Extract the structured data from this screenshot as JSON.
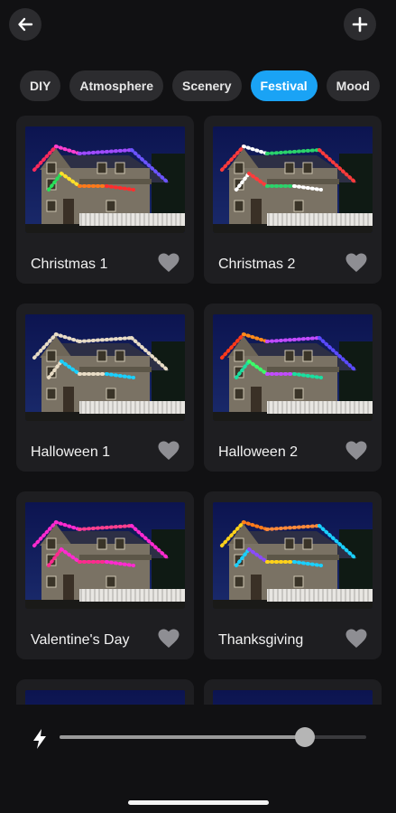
{
  "header": {
    "back_icon": "arrow-left-icon",
    "add_icon": "plus-icon"
  },
  "tabs": [
    {
      "label": "DIY",
      "active": false
    },
    {
      "label": "Atmosphere",
      "active": false
    },
    {
      "label": "Scenery",
      "active": false
    },
    {
      "label": "Festival",
      "active": true
    },
    {
      "label": "Mood",
      "active": false
    }
  ],
  "presets": [
    {
      "title": "Christmas 1",
      "roof_colors": [
        "#ff2a5c",
        "#ff3fd0",
        "#a04bff",
        "#6b54ff",
        "#2bd36b"
      ],
      "lower_colors": [
        "#28e05a",
        "#ffe02a",
        "#ff7a1a",
        "#ff2e2e"
      ],
      "favorite": false
    },
    {
      "title": "Christmas 2",
      "roof_colors": [
        "#ff3b3b",
        "#ffffff",
        "#2bd36b",
        "#ff3b3b"
      ],
      "lower_colors": [
        "#ffffff",
        "#ff3b3b",
        "#2bd36b"
      ],
      "favorite": false
    },
    {
      "title": "Halloween 1",
      "roof_colors": [
        "#e8dcc6",
        "#e8dcc6"
      ],
      "lower_colors": [
        "#e8dcc6",
        "#1ad0ff"
      ],
      "favorite": false
    },
    {
      "title": "Halloween 2",
      "roof_colors": [
        "#ff3a1a",
        "#ff8a1a",
        "#c24bff",
        "#5b4bff"
      ],
      "lower_colors": [
        "#1adfa0",
        "#3aff6a",
        "#c24bff"
      ],
      "favorite": false
    },
    {
      "title": "Valentine's Day",
      "roof_colors": [
        "#ff2ad0",
        "#ff2ad0",
        "#ff3f8f"
      ],
      "lower_colors": [
        "#ff2a8f",
        "#ff2ad0"
      ],
      "favorite": false
    },
    {
      "title": "Thanksgiving",
      "roof_colors": [
        "#ffd21a",
        "#ff7a1a",
        "#ff8a3a",
        "#1ad0ff"
      ],
      "lower_colors": [
        "#1ad0ff",
        "#8a4bff",
        "#ffd21a"
      ],
      "favorite": false
    },
    {
      "title": "",
      "roof_colors": [],
      "lower_colors": [],
      "favorite": false
    },
    {
      "title": "",
      "roof_colors": [],
      "lower_colors": [],
      "favorite": false
    }
  ],
  "brightness": {
    "icon": "lightning-bolt-icon",
    "level": 0.8
  },
  "colors": {
    "accent": "#1aa3f5",
    "background": "#111113",
    "card": "#1e1e21",
    "heart": "#8e8e93"
  }
}
